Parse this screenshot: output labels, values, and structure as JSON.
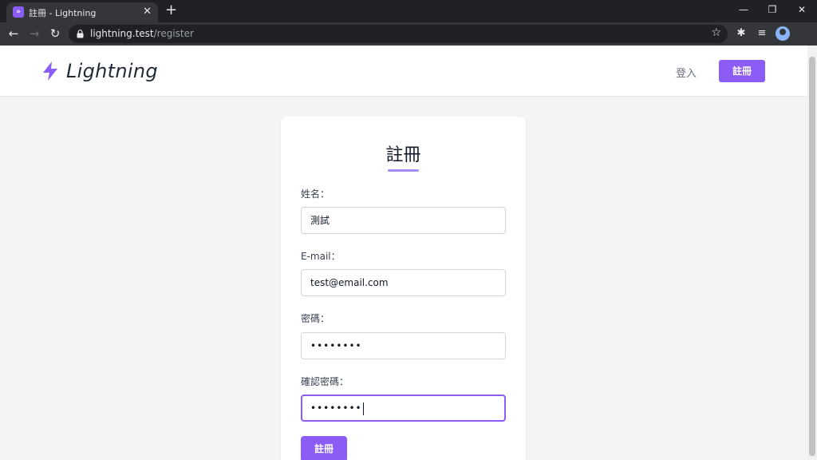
{
  "browser": {
    "tab_title": "註冊 - Lightning",
    "tab_close": "✕",
    "new_tab": "+",
    "url_host": "lightning.test",
    "url_path": "/register",
    "window_controls": [
      "—",
      "❐",
      "✕"
    ]
  },
  "header": {
    "logo_text": "Lightning",
    "login_label": "登入",
    "register_label": "註冊"
  },
  "form": {
    "title": "註冊",
    "fields": [
      {
        "label": "姓名：",
        "value": "測試"
      },
      {
        "label": "E-mail：",
        "value": "test@email.com"
      },
      {
        "label": "密碼：",
        "value": "••••••••"
      },
      {
        "label": "確認密碼：",
        "value": "••••••••"
      }
    ],
    "submit_label": "註冊"
  },
  "colors": {
    "accent": "#8b5cf6",
    "accent_light": "#a78bfa"
  }
}
